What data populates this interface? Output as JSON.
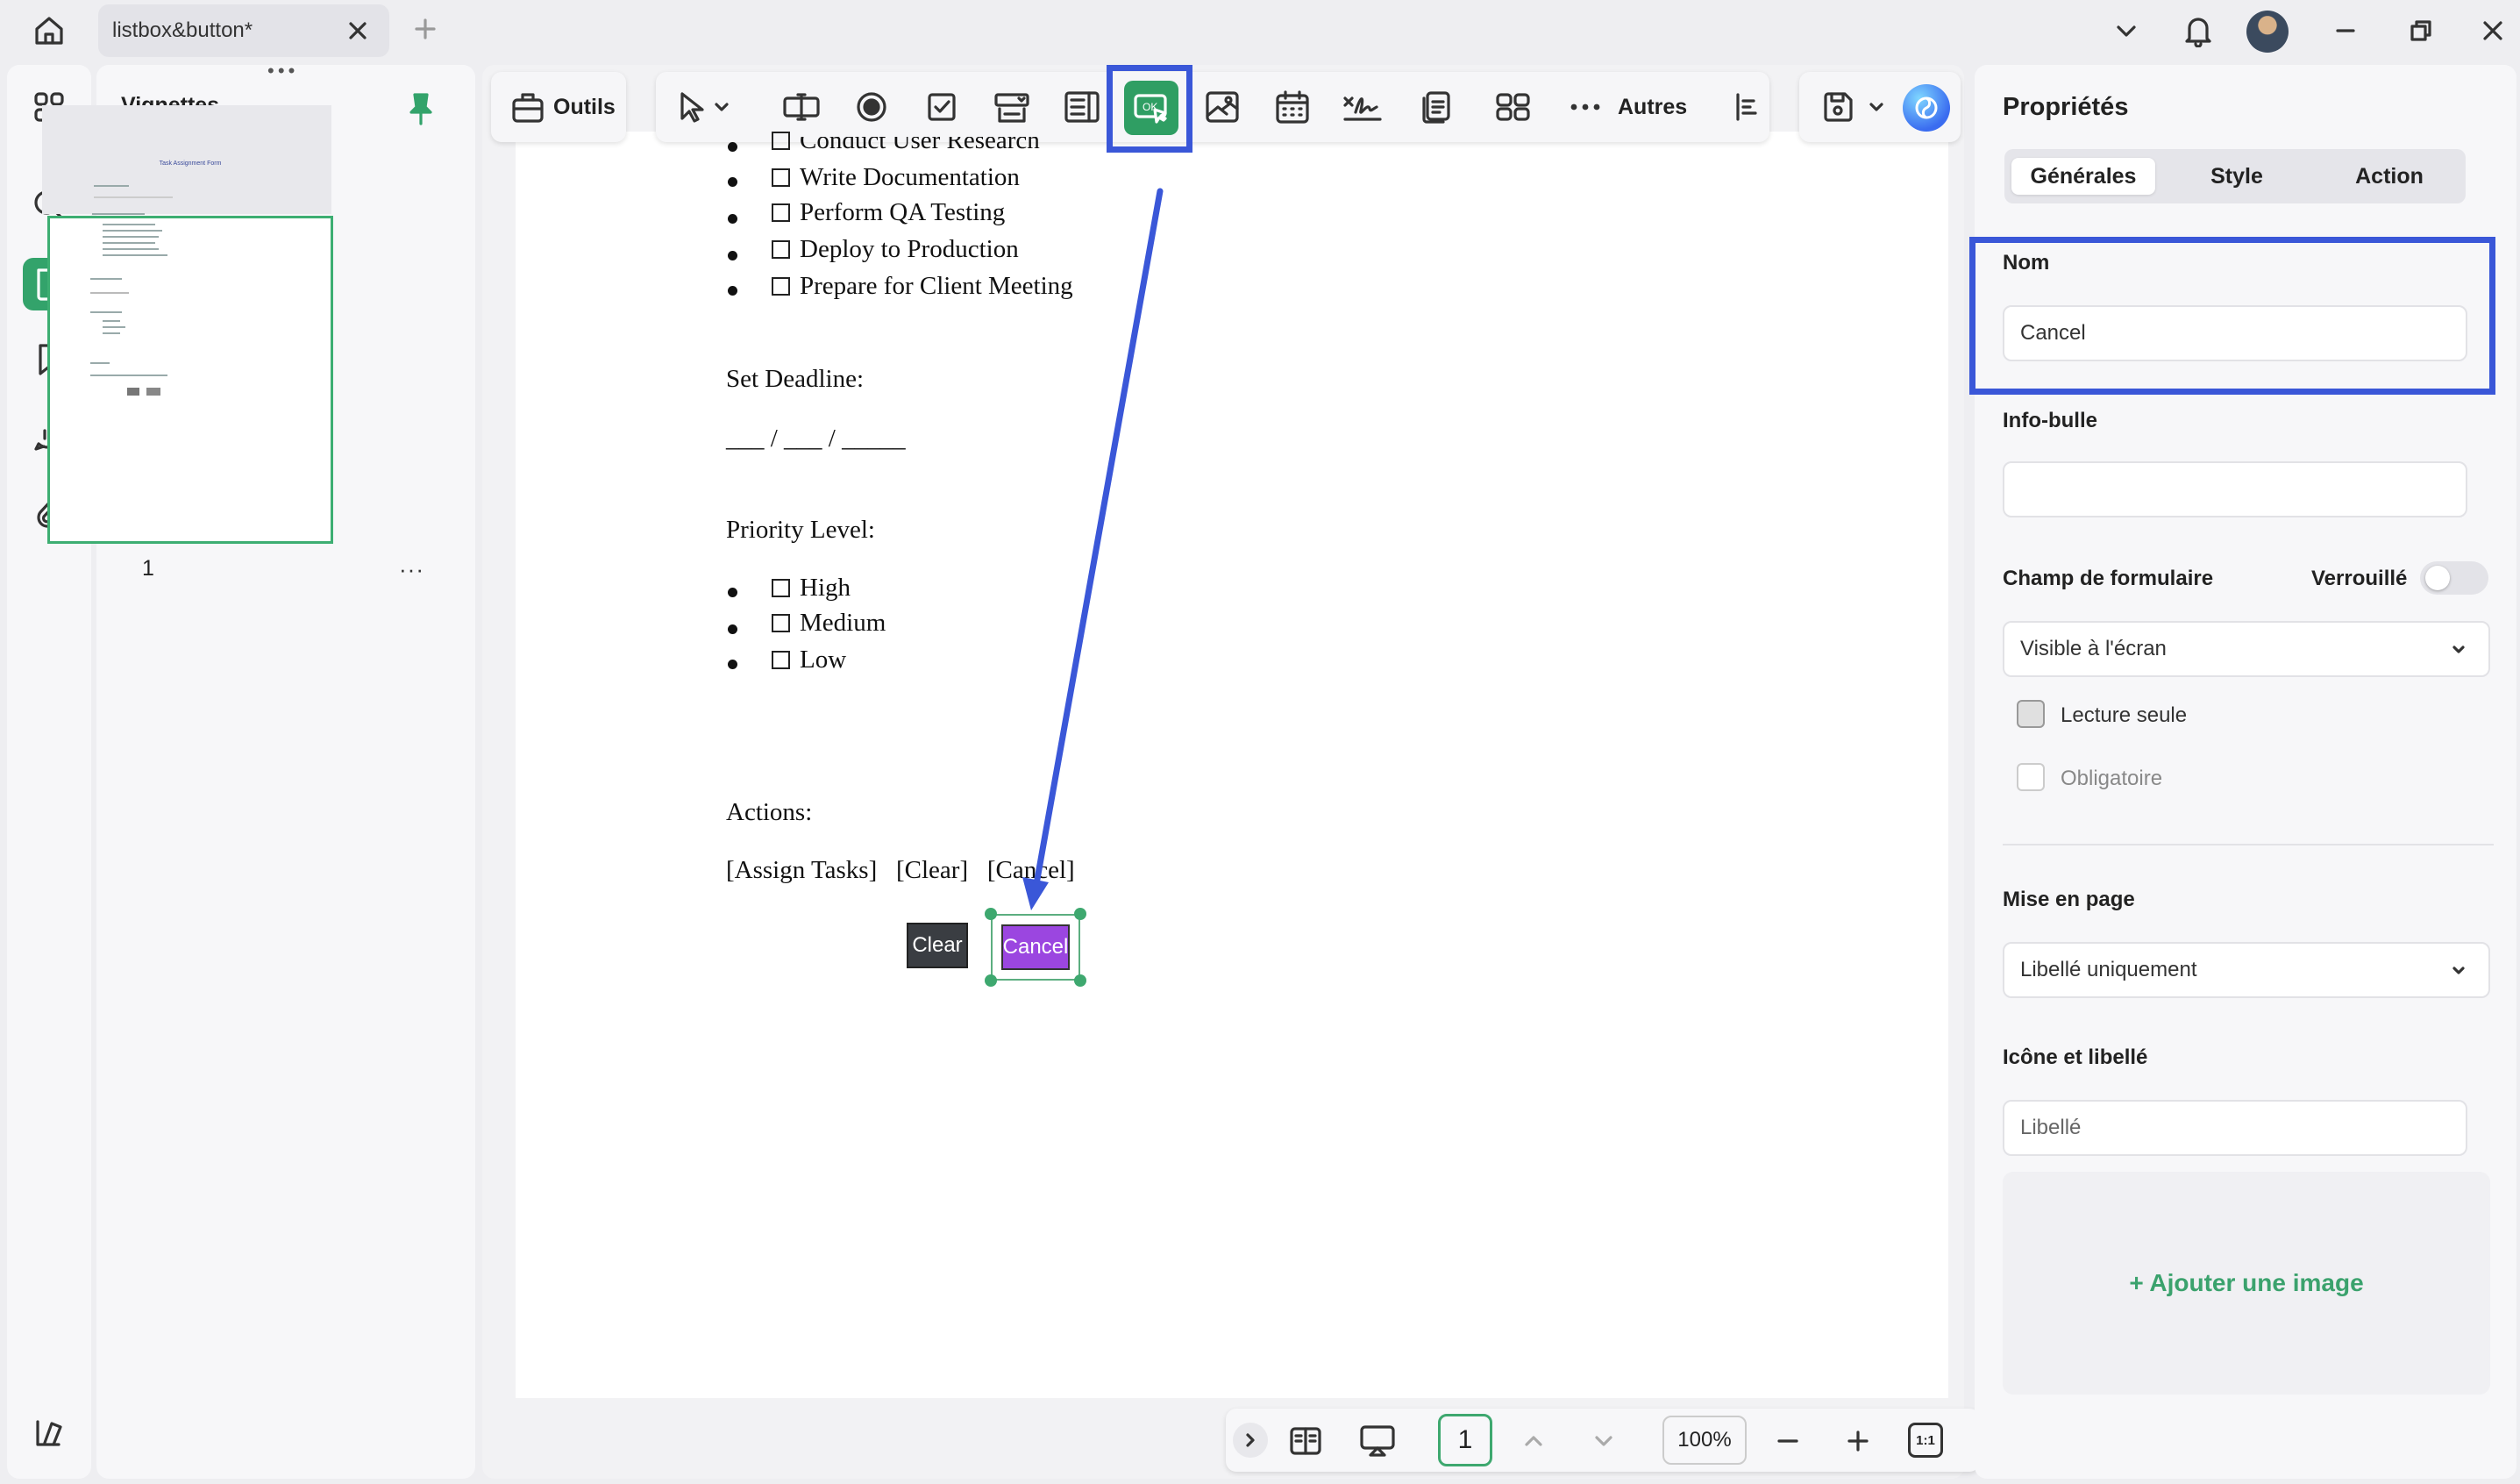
{
  "titlebar": {
    "tab_title": "listbox&button*"
  },
  "thumbnails": {
    "title": "Vignettes",
    "page_number": "1",
    "more": "···",
    "mini_title": "Task Assignment Form"
  },
  "toolbar": {
    "outils": "Outils",
    "autres": "Autres"
  },
  "document": {
    "tasks": [
      "Conduct User Research",
      "Write Documentation",
      "Perform QA Testing",
      "Deploy to Production",
      "Prepare for Client Meeting"
    ],
    "deadline_label": "Set Deadline:",
    "deadline_blank": "___ / ___ / _____",
    "priority_label": "Priority Level:",
    "priorities": [
      "High",
      "Medium",
      "Low"
    ],
    "actions_label": "Actions:",
    "actions_line": "[Assign Tasks]   [Clear]   [Cancel]",
    "clear_button": "Clear",
    "cancel_button": "Cancel"
  },
  "bottombar": {
    "page": "1",
    "zoom": "100%",
    "fit": "1:1"
  },
  "properties": {
    "title": "Propriétés",
    "tabs": [
      "Générales",
      "Style",
      "Action"
    ],
    "active_tab": "Générales",
    "nom_label": "Nom",
    "nom_value": "Cancel",
    "infobulle_label": "Info-bulle",
    "infobulle_value": "",
    "champ_label": "Champ de formulaire",
    "verrouille_label": "Verrouillé",
    "visibility": "Visible à l'écran",
    "lecture_seule": "Lecture seule",
    "obligatoire": "Obligatoire",
    "mise_en_page_label": "Mise en page",
    "mise_en_page_value": "Libellé uniquement",
    "icone_label": "Icône et libellé",
    "libelle_placeholder": "Libellé",
    "add_image": "+ Ajouter une image"
  },
  "colors": {
    "accent_green": "#33a36b",
    "highlight_blue": "#3a57d8",
    "cancel_purple": "#9b46e0"
  }
}
